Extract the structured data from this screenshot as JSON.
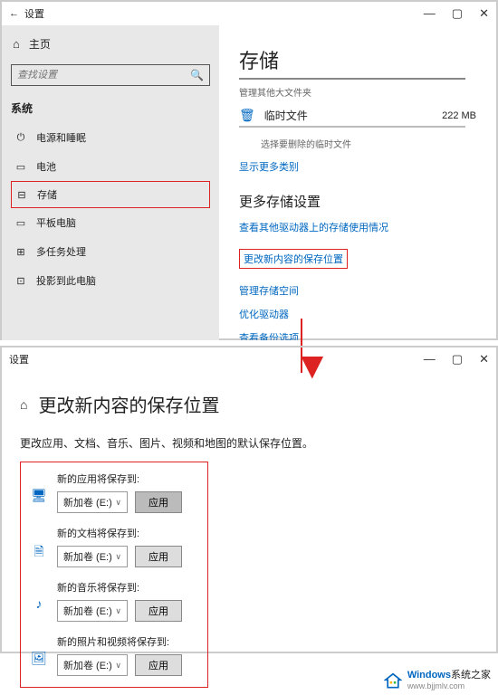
{
  "window1": {
    "title": "设置",
    "sidebar": {
      "home": "主页",
      "search_placeholder": "查找设置",
      "section": "系统",
      "items": [
        {
          "icon": "⏻",
          "label": "电源和睡眠"
        },
        {
          "icon": "▭",
          "label": "电池"
        },
        {
          "icon": "⊟",
          "label": "存储",
          "highlighted": true
        },
        {
          "icon": "▭",
          "label": "平板电脑"
        },
        {
          "icon": "⊞",
          "label": "多任务处理"
        },
        {
          "icon": "⊡",
          "label": "投影到此电脑"
        }
      ]
    },
    "main": {
      "title": "存储",
      "sub1": "管理其他大文件夹",
      "temp": {
        "label": "临时文件",
        "value": "222 MB",
        "sub": "选择要删除的临时文件"
      },
      "show_more": "显示更多类别",
      "more_title": "更多存储设置",
      "links": [
        {
          "label": "查看其他驱动器上的存储使用情况"
        },
        {
          "label": "更改新内容的保存位置",
          "highlighted": true
        },
        {
          "label": "管理存储空间"
        },
        {
          "label": "优化驱动器"
        },
        {
          "label": "查看备份选项"
        }
      ]
    }
  },
  "window2": {
    "title": "设置",
    "page_title": "更改新内容的保存位置",
    "desc": "更改应用、文档、音乐、图片、视频和地图的默认保存位置。",
    "items": [
      {
        "icon": "🖥",
        "label": "新的应用将保存到:",
        "value": "新加卷 (E:)",
        "active": true
      },
      {
        "icon": "🗎",
        "label": "新的文档将保存到:",
        "value": "新加卷 (E:)"
      },
      {
        "icon": "♪",
        "label": "新的音乐将保存到:",
        "value": "新加卷 (E:)"
      },
      {
        "icon": "🖼",
        "label": "新的照片和视频将保存到:",
        "value": "新加卷 (E:)"
      }
    ],
    "apply": "应用"
  },
  "watermark": {
    "brand1": "Windows",
    "brand2": "系统之家",
    "url": "www.bjjmlv.com"
  }
}
